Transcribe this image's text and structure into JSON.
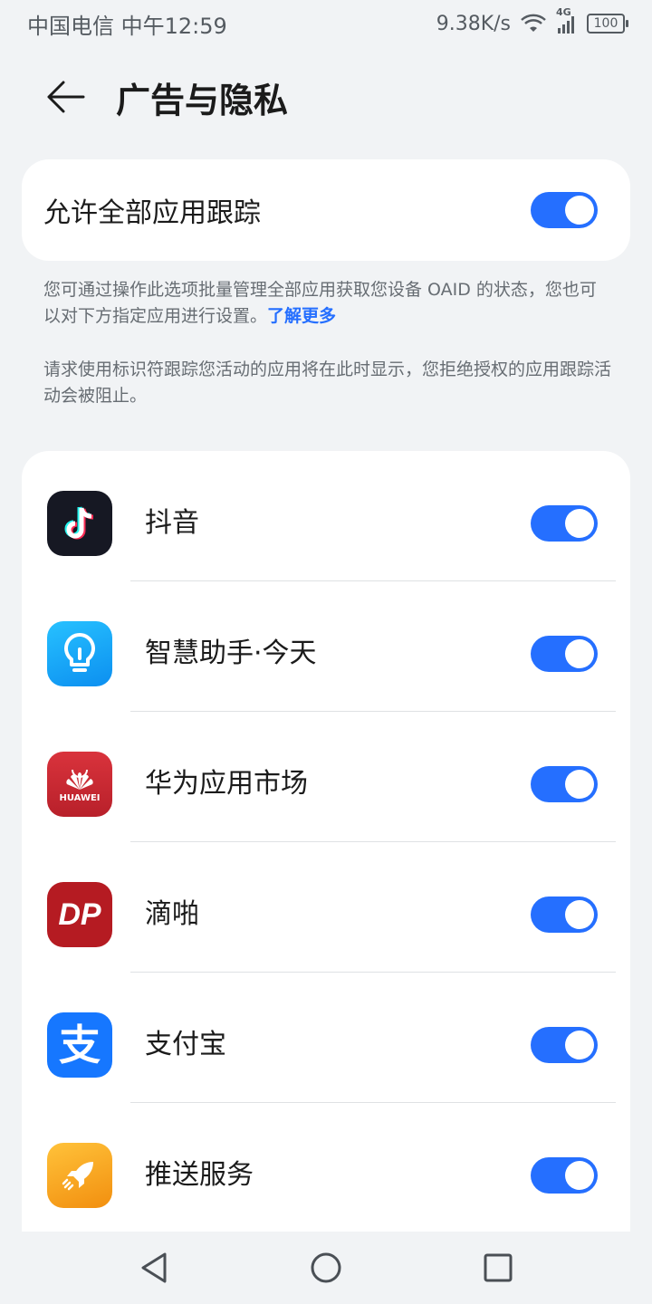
{
  "status": {
    "carrier_time": "中国电信 中午12:59",
    "speed": "9.38K/s",
    "network": "4G",
    "battery": "100"
  },
  "header": {
    "title": "广告与隐私",
    "back_icon": "back-arrow-icon"
  },
  "master": {
    "label": "允许全部应用跟踪",
    "enabled": true
  },
  "descriptions": {
    "text1": "您可通过操作此选项批量管理全部应用获取您设备 OAID 的状态，您也可以对下方指定应用进行设置。",
    "link": "了解更多",
    "text2": "请求使用标识符跟踪您活动的应用将在此时显示，您拒绝授权的应用跟踪活动会被阻止。"
  },
  "apps": [
    {
      "name": "抖音",
      "icon": "douyin-icon",
      "color": "#161823",
      "enabled": true
    },
    {
      "name": "智慧助手·今天",
      "icon": "lightbulb-icon",
      "color": "#12a9f4",
      "enabled": true
    },
    {
      "name": "华为应用市场",
      "icon": "huawei-appgallery-icon",
      "logo_text": "HUAWEI",
      "color": "#c9262f",
      "enabled": true
    },
    {
      "name": "滴啪",
      "icon": "dp-icon",
      "logo_text": "DP",
      "color": "#b51b22",
      "enabled": true
    },
    {
      "name": "支付宝",
      "icon": "alipay-icon",
      "logo_text": "支",
      "color": "#1677ff",
      "enabled": true
    },
    {
      "name": "推送服务",
      "icon": "rocket-icon",
      "color": "#f7a21b",
      "enabled": true
    }
  ],
  "colors": {
    "accent": "#256fff",
    "background": "#f1f3f5",
    "card": "#ffffff"
  },
  "nav": {
    "back_icon": "triangle-back-icon",
    "home_icon": "circle-home-icon",
    "recent_icon": "square-recent-icon"
  }
}
